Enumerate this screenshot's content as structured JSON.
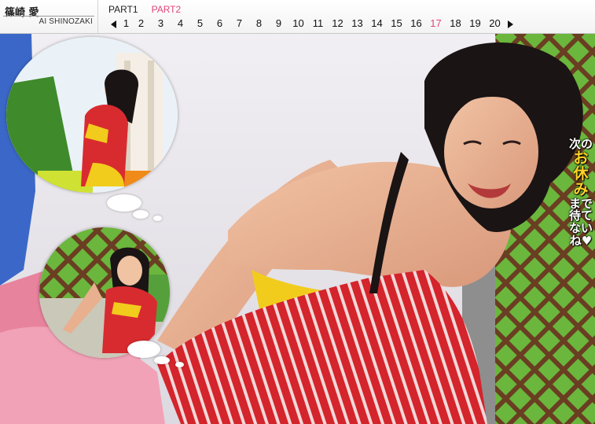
{
  "header": {
    "name_ja": "篠崎 愛",
    "name_en": "AI SHINOZAKI",
    "parts": [
      {
        "label": "PART1",
        "active": false
      },
      {
        "label": "PART2",
        "active": true
      }
    ],
    "pages": [
      "1",
      "2",
      "3",
      "4",
      "5",
      "6",
      "7",
      "8",
      "9",
      "10",
      "11",
      "12",
      "13",
      "14",
      "15",
      "16",
      "17",
      "18",
      "19",
      "20"
    ],
    "current_page": "17",
    "accent_color": "#e0457b"
  },
  "caption": {
    "line1": "次の",
    "line2": "お休み",
    "line3": "まで待てないね♥"
  },
  "icons": {
    "prev": "triangle-left-icon",
    "next": "triangle-right-icon"
  }
}
